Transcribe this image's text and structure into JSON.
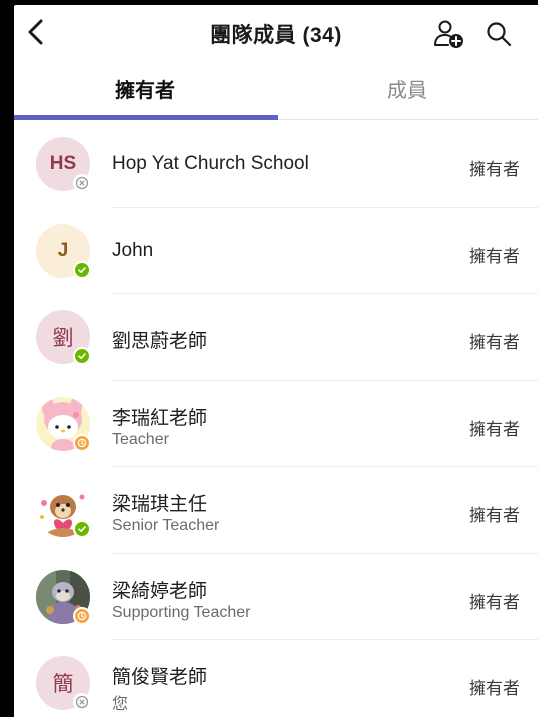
{
  "header": {
    "title": "團隊成員 (34)",
    "back_icon": "chevron-left-icon",
    "add_member_icon": "add-person-icon",
    "search_icon": "search-icon"
  },
  "tabs": [
    {
      "label": "擁有者",
      "active": true
    },
    {
      "label": "成員",
      "active": false
    }
  ],
  "colors": {
    "accent": "#5b5fc7",
    "available": "#6bb700",
    "away": "#f8a53b"
  },
  "members": [
    {
      "initials": "HS",
      "name": "Hop Yat Church School",
      "subtitle": "",
      "role": "擁有者",
      "status": "offline",
      "avatar": "initials-pink"
    },
    {
      "initials": "J",
      "name": "John",
      "subtitle": "",
      "role": "擁有者",
      "status": "available",
      "avatar": "initials-cream"
    },
    {
      "initials": "劉",
      "name": "劉思蔚老師",
      "subtitle": "",
      "role": "擁有者",
      "status": "available",
      "avatar": "initials-pink"
    },
    {
      "initials": "",
      "name": "李瑞紅老師",
      "subtitle": "Teacher",
      "role": "擁有者",
      "status": "away",
      "avatar": "image-melody"
    },
    {
      "initials": "",
      "name": "梁瑞琪主任",
      "subtitle": "Senior Teacher",
      "role": "擁有者",
      "status": "available",
      "avatar": "image-chipmunk"
    },
    {
      "initials": "",
      "name": "梁綺婷老師",
      "subtitle": "Supporting Teacher",
      "role": "擁有者",
      "status": "away",
      "avatar": "image-photo"
    },
    {
      "initials": "簡",
      "name": "簡俊賢老師",
      "subtitle": "您",
      "role": "擁有者",
      "status": "offline",
      "avatar": "initials-pink"
    }
  ]
}
